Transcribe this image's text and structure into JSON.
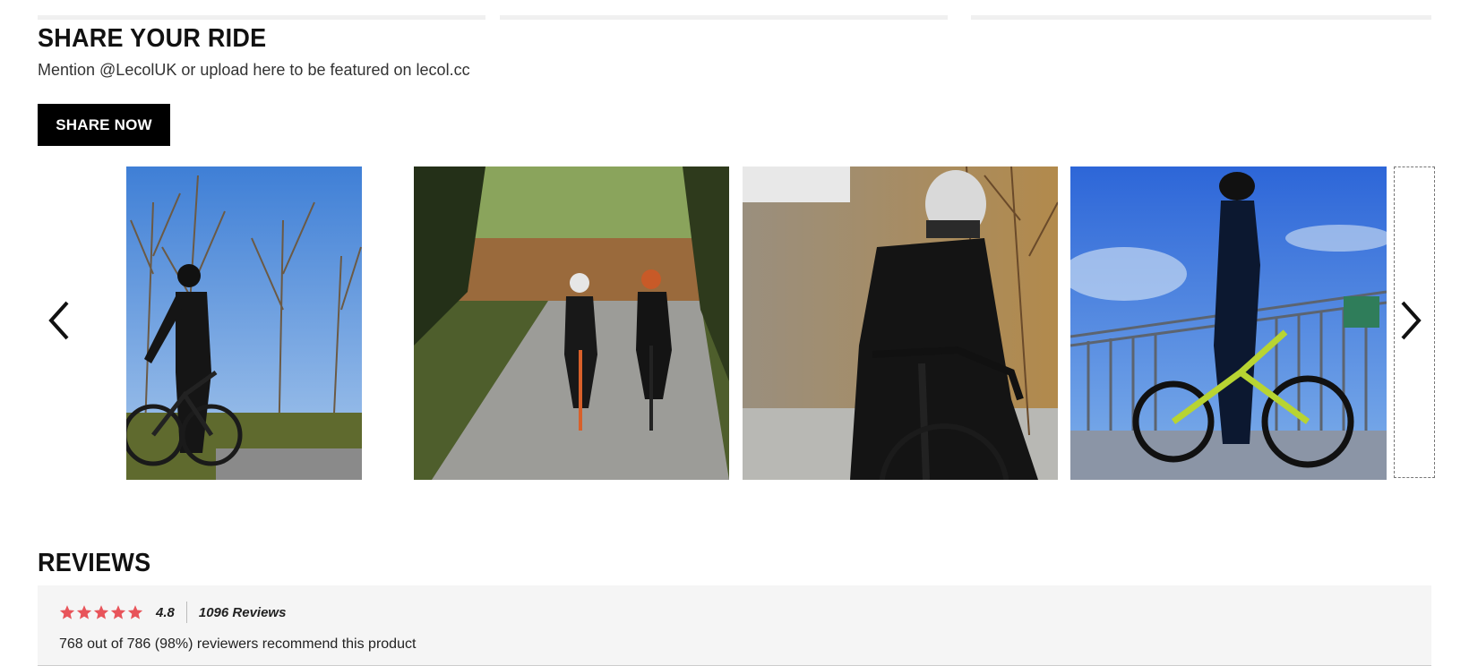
{
  "share": {
    "title": "SHARE YOUR RIDE",
    "subtitle": "Mention @LecolUK or upload here to be featured on lecol.cc",
    "button_label": "SHARE NOW"
  },
  "carousel": {
    "prev_icon": "chevron-left-icon",
    "next_icon": "chevron-right-icon",
    "photos": [
      {
        "alt": "Cyclist in black kit standing with bike under bare trees and blue sky"
      },
      {
        "alt": "Two cyclists riding on a country road"
      },
      {
        "alt": "Cyclist in white helmet leaning on handlebars"
      },
      {
        "alt": "Cyclist on yellow-green bike by a seaside railing"
      }
    ]
  },
  "reviews": {
    "title": "REVIEWS",
    "rating": "4.8",
    "review_count": "1096 Reviews",
    "recommend": "768 out of 786 (98%) reviewers recommend this product",
    "star_color": "#e8545a",
    "stars": 5
  }
}
